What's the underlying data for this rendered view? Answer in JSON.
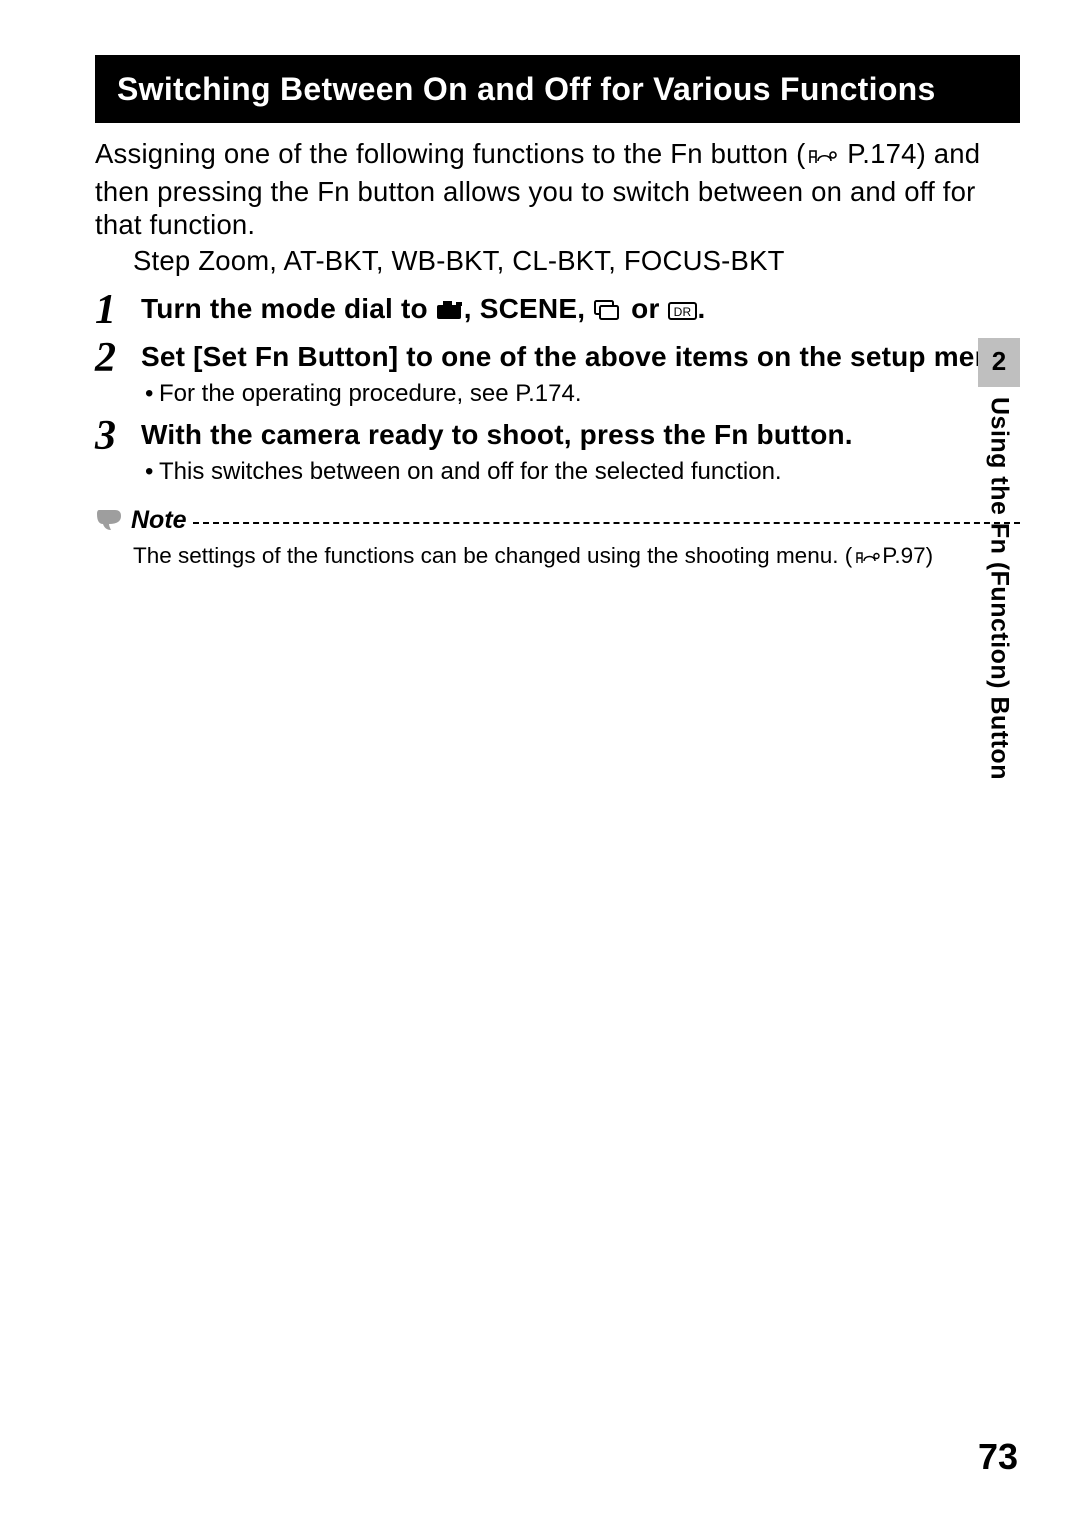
{
  "title": "Switching Between On and Off for Various Functions",
  "intro_main": "Assigning one of the following functions to the Fn button (",
  "intro_ref": " P.174) and then pressing the Fn button allows you to switch between on and off for that function.",
  "intro_sub": "Step Zoom, AT-BKT, WB-BKT, CL-BKT, FOCUS-BKT",
  "steps": {
    "s1_pre": "Turn the mode dial to ",
    "s1_mid": ", SCENE, ",
    "s1_or": " or ",
    "s1_end": ".",
    "s2_title": "Set [Set Fn Button] to one of the above items on the setup menu.",
    "s2_bullet": "For the operating procedure, see P.174.",
    "s3_title": "With the camera ready to shoot, press the Fn button.",
    "s3_bullet": "This switches between on and off for the selected function."
  },
  "note_label": "Note",
  "note_text_pre": "The settings of the functions can be changed using the shooting menu. (",
  "note_text_post": "P.97)",
  "side_chapter": "2",
  "side_label": "Using the Fn (Function) Button",
  "page_number": "73"
}
